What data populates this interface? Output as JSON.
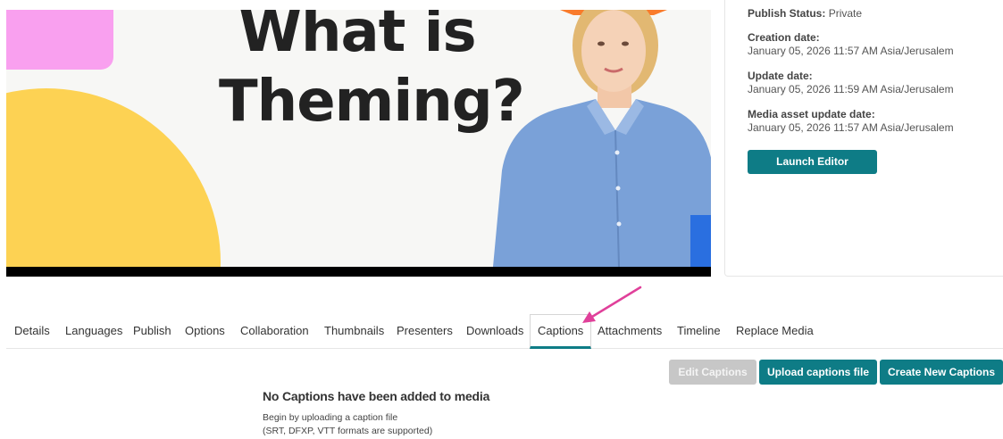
{
  "video": {
    "headline_line1": "What is",
    "headline_line2": "Theming?"
  },
  "info": {
    "publish_status_label": "Publish Status:",
    "publish_status_value": "Private",
    "creation_date_label": "Creation date:",
    "creation_date_value": "January 05, 2026 11:57 AM Asia/Jerusalem",
    "update_date_label": "Update date:",
    "update_date_value": "January 05, 2026 11:59 AM Asia/Jerusalem",
    "media_update_label": "Media asset update date:",
    "media_update_value": "January 05, 2026 11:57 AM Asia/Jerusalem",
    "launch_editor_label": "Launch Editor"
  },
  "tabs": {
    "details": "Details",
    "languages": "Languages",
    "publish": "Publish",
    "options": "Options",
    "collaboration": "Collaboration",
    "thumbnails": "Thumbnails",
    "presenters": "Presenters",
    "downloads": "Downloads",
    "captions": "Captions",
    "attachments": "Attachments",
    "timeline": "Timeline",
    "replace_media": "Replace Media",
    "active": "Captions"
  },
  "captions": {
    "edit_label": "Edit Captions",
    "upload_label": "Upload captions file",
    "create_label": "Create New Captions",
    "empty_title": "No Captions have been added to media",
    "empty_line1": "Begin by uploading a caption file",
    "empty_line2": "(SRT, DFXP, VTT formats are supported)"
  },
  "colors": {
    "accent": "#0e7c86",
    "annotation_arrow": "#e0409a",
    "disabled": "#c7c7c7"
  },
  "icons": [
    "annotation-arrow-icon"
  ]
}
